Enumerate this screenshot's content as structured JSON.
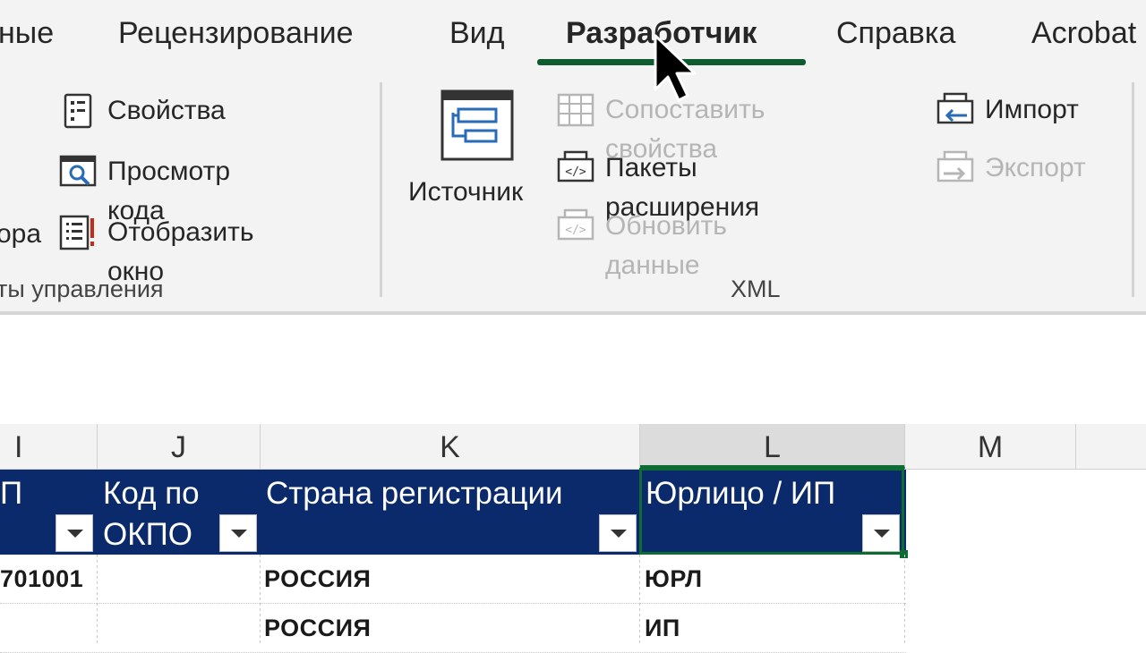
{
  "tabs": [
    {
      "label": "ные",
      "active": false
    },
    {
      "label": "Рецензирование",
      "active": false
    },
    {
      "label": "Вид",
      "active": false
    },
    {
      "label": "Разработчик",
      "active": true
    },
    {
      "label": "Справка",
      "active": false
    },
    {
      "label": "Acrobat",
      "active": false
    }
  ],
  "ribbon": {
    "controls": {
      "partial_label": "ора",
      "properties": "Свойства",
      "view_code": "Просмотр кода",
      "show_window": "Отобразить окно",
      "group_label": "ты управления"
    },
    "xml": {
      "source": "Источник",
      "map_properties": "Сопоставить свойства",
      "expansion_packs": "Пакеты расширения",
      "refresh_data": "Обновить данные",
      "import": "Импорт",
      "export": "Экспорт",
      "group_label": "XML"
    }
  },
  "grid": {
    "columns": [
      "I",
      "J",
      "K",
      "L",
      "M"
    ],
    "selected_column": "L",
    "headers": [
      "П",
      "Код по ОКПО",
      "Страна регистрации",
      "Юрлицо / ИП"
    ],
    "rows": [
      [
        "701001",
        "",
        "РОССИЯ",
        "ЮРЛ"
      ],
      [
        "",
        "",
        "РОССИЯ",
        "ИП"
      ]
    ]
  },
  "colors": {
    "accent_green": "#0e5c2f",
    "table_header_bg": "#0b2a6b",
    "disabled_text": "#b5b5b5"
  }
}
